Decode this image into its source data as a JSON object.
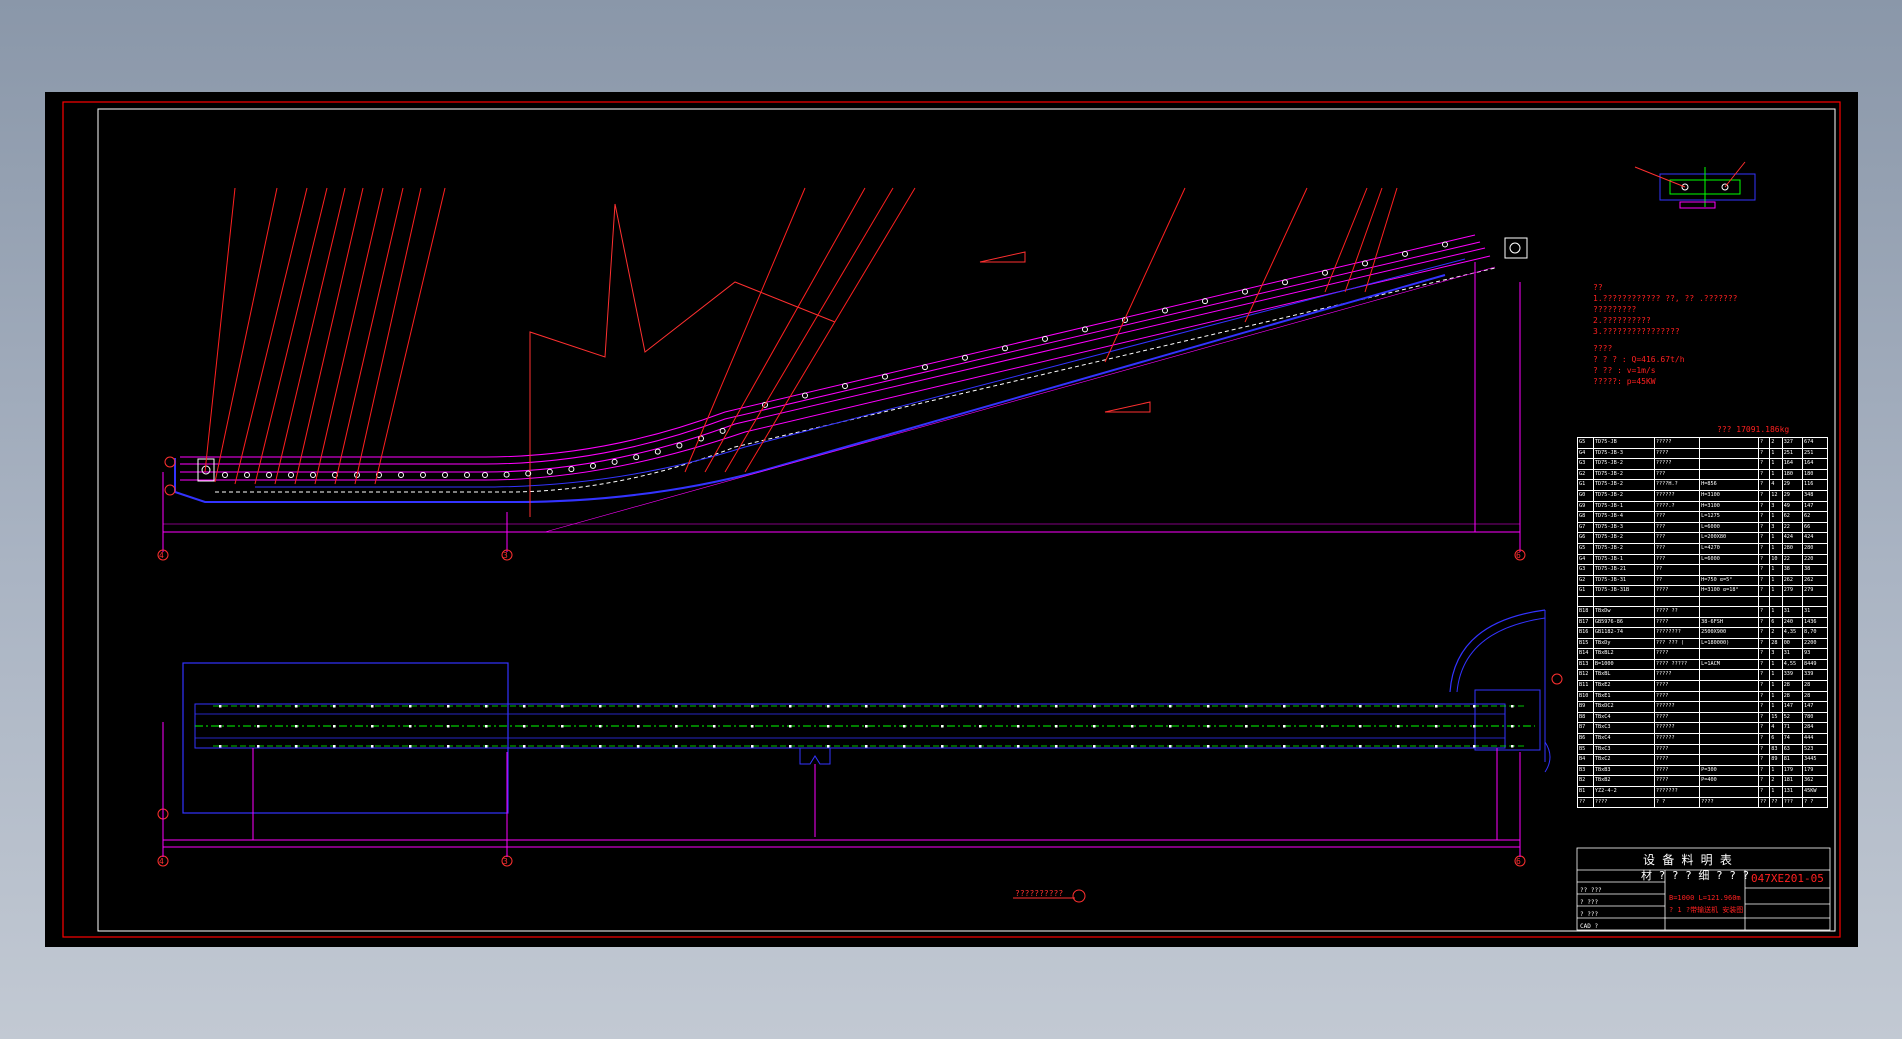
{
  "notes": {
    "heading": "??",
    "lines": [
      "1.????????????  ??, ?? .???????",
      "  ?????????",
      "2.??????????",
      "3.????????????????"
    ],
    "param_heading": "????",
    "params": [
      "? ? ? : Q=416.67t/h",
      "?  ?? : v=1m/s",
      "?????: p=45KW"
    ]
  },
  "total_weight": "???  17091.186kg",
  "bom_rows": [
    [
      "G5",
      "TD75-JB",
      "?????",
      "",
      "?",
      "2",
      "327",
      "674"
    ],
    [
      "G4",
      "TD75-JB-3",
      "????",
      "",
      "?",
      "1",
      "251",
      "251"
    ],
    [
      "G3",
      "TD75-JB-2",
      "?????",
      "",
      "?",
      "1",
      "164",
      "164"
    ],
    [
      "G2",
      "TD75-JB-2",
      "???",
      "",
      "?",
      "1",
      "180",
      "180"
    ],
    [
      "G1",
      "TD75-JB-2",
      "????H.?",
      "H=856",
      "?",
      "4",
      "29",
      "116"
    ],
    [
      "G0",
      "TD75-JB-2",
      "??????",
      "H=3100",
      "?",
      "12",
      "29",
      "348"
    ],
    [
      "G9",
      "TD75-JB-1",
      "????.?",
      "H=3100",
      "?",
      "3",
      "49",
      "147"
    ],
    [
      "G8",
      "TD75-JB-4",
      "???",
      "L=1275",
      "?",
      "1",
      "62",
      "62"
    ],
    [
      "G7",
      "TD75-JB-3",
      "???",
      "L=6000",
      "?",
      "3",
      "22",
      "66"
    ],
    [
      "G6",
      "TD75-JB-2",
      "???",
      "L=200X80",
      "?",
      "1",
      "424",
      "424"
    ],
    [
      "G5",
      "TD75-JB-2",
      "???",
      "L=4270",
      "?",
      "1",
      "280",
      "280"
    ],
    [
      "G4",
      "TD75-JB-1",
      "???",
      "L=6000",
      "?",
      "10",
      "22",
      "220"
    ],
    [
      "G3",
      "TD75-JB-21",
      "??",
      "",
      "?",
      "1",
      "38",
      "38"
    ],
    [
      "G2",
      "TD75-JB-31",
      "??",
      "H=750 α=5°",
      "?",
      "1",
      "262",
      "262"
    ],
    [
      "G1",
      "TD75-JB-31B",
      "????",
      "H=3100 α=18°",
      "?",
      "1",
      "279",
      "279"
    ],
    [
      "",
      "",
      "",
      "",
      "",
      "",
      "",
      ""
    ],
    [
      "B18",
      "TBxDw",
      "???? ??",
      "",
      "?",
      "1",
      "31",
      "31"
    ],
    [
      "B17",
      "GB5976-86",
      "????",
      "38-6FSH",
      "?",
      "6",
      "240",
      "1436"
    ],
    [
      "B16",
      "GB1182-74",
      "????????",
      "2500X900",
      "?",
      "2",
      "4,35",
      "8,70"
    ],
    [
      "B15",
      "TBxDy",
      "??? ??? (",
      "L=180000)",
      "?",
      "28",
      "00",
      "2200"
    ],
    [
      "B14",
      "TBxBL2",
      "????",
      "",
      "?",
      "3",
      "31",
      "93"
    ],
    [
      "B13",
      "B=1000",
      "???? ?????",
      "L=1ACM",
      "?",
      "1",
      "4,55",
      "8449"
    ],
    [
      "B12",
      "TBxBL",
      "?????",
      "",
      "?",
      "1",
      "339",
      "339"
    ],
    [
      "B11",
      "TBxE2",
      "????",
      "",
      "?",
      "1",
      "28",
      "28"
    ],
    [
      "B10",
      "TBxE1",
      "????",
      "",
      "?",
      "1",
      "28",
      "28"
    ],
    [
      "B9",
      "TBxDC2",
      "??????",
      "",
      "?",
      "1",
      "147",
      "147"
    ],
    [
      "B8",
      "TBxC4",
      "????",
      "",
      "?",
      "15",
      "52",
      "780"
    ],
    [
      "B7",
      "TBxC3",
      "??????",
      "",
      "?",
      "4",
      "71",
      "284"
    ],
    [
      "B6",
      "TBxC4",
      "??????",
      "",
      "?",
      "6",
      "74",
      "444"
    ],
    [
      "B5",
      "TBxC3",
      "????",
      "",
      "?",
      "83",
      "63",
      "523"
    ],
    [
      "B4",
      "TBxC2",
      "????",
      "",
      "?",
      "89",
      "81",
      "3445"
    ],
    [
      "B3",
      "TBxB3",
      "????",
      "P=300",
      "?",
      "1",
      "179",
      "179"
    ],
    [
      "B2",
      "TBxB2",
      "????",
      "P=400",
      "?",
      "2",
      "181",
      "362"
    ],
    [
      "B1",
      "YZ2-4-2",
      "???????",
      "",
      "?",
      "1",
      "131",
      "45KW"
    ]
  ],
  "bom_header": [
    "??",
    "????",
    "? ?",
    "????",
    "??",
    "??",
    "???",
    "? ?"
  ],
  "bom_title": "设 备 料 明 表",
  "bom_subtitle": "材 ? ? ? 细 ? ? ?",
  "drawing_number": "047XE201-05",
  "project_line1": "B=1000  L=121.960m",
  "project_line2": "? 1 ?带输送机 安装图",
  "title_block_left": [
    "??  ???",
    "?  ???",
    "?  ???",
    "CAD  ?"
  ],
  "plan_view_label": "??????????",
  "axis_markers": [
    "④",
    "③",
    "⑥",
    "⑤",
    "⑦"
  ],
  "colors": {
    "frame": "#ff0000",
    "belt": "#ff00ff",
    "outline": "#0000ff",
    "text": "#ff3030",
    "centerline": "#00ff00",
    "white": "#ffffff",
    "yellow": "#ffff00"
  }
}
